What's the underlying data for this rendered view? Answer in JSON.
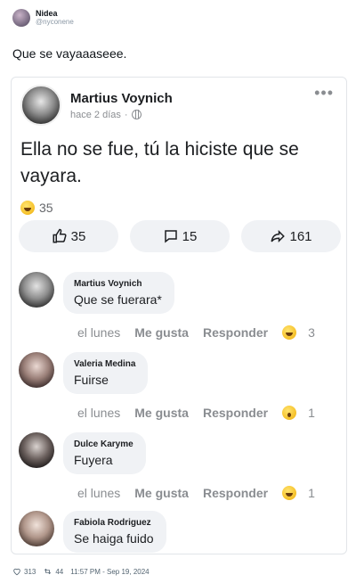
{
  "tweet": {
    "author_name": "Nidea",
    "author_handle": "@nyconene",
    "text": "Que se vayaaaseee.",
    "likes": "313",
    "retweets": "44",
    "timestamp": "11:57 PM - Sep 19, 2024"
  },
  "fb_post": {
    "author": "Martius Voynich",
    "time": "hace 2 días",
    "body": "Ella no se fue, tú la hiciste que se vayara.",
    "reaction_count": "35",
    "actions": {
      "like_count": "35",
      "comment_count": "15",
      "share_count": "161"
    }
  },
  "comments": [
    {
      "name": "Martius Voynich",
      "text": "Que se fuerara*",
      "time": "el lunes",
      "like_label": "Me gusta",
      "reply_label": "Responder",
      "reaction": "laugh-emoji",
      "reaction_count": "3"
    },
    {
      "name": "Valeria Medina",
      "text": "Fuirse",
      "time": "el lunes",
      "like_label": "Me gusta",
      "reply_label": "Responder",
      "reaction": "wow-emoji",
      "reaction_count": "1"
    },
    {
      "name": "Dulce Karyme",
      "text": "Fuyera",
      "time": "el lunes",
      "like_label": "Me gusta",
      "reply_label": "Responder",
      "reaction": "laugh-emoji",
      "reaction_count": "1"
    },
    {
      "name": "Fabiola Rodriguez",
      "text": "Se haiga fuido"
    }
  ],
  "colors": {
    "bubble_bg": "#f0f2f5",
    "muted_text": "#8a8d91",
    "primary_text": "#1c1e21"
  }
}
